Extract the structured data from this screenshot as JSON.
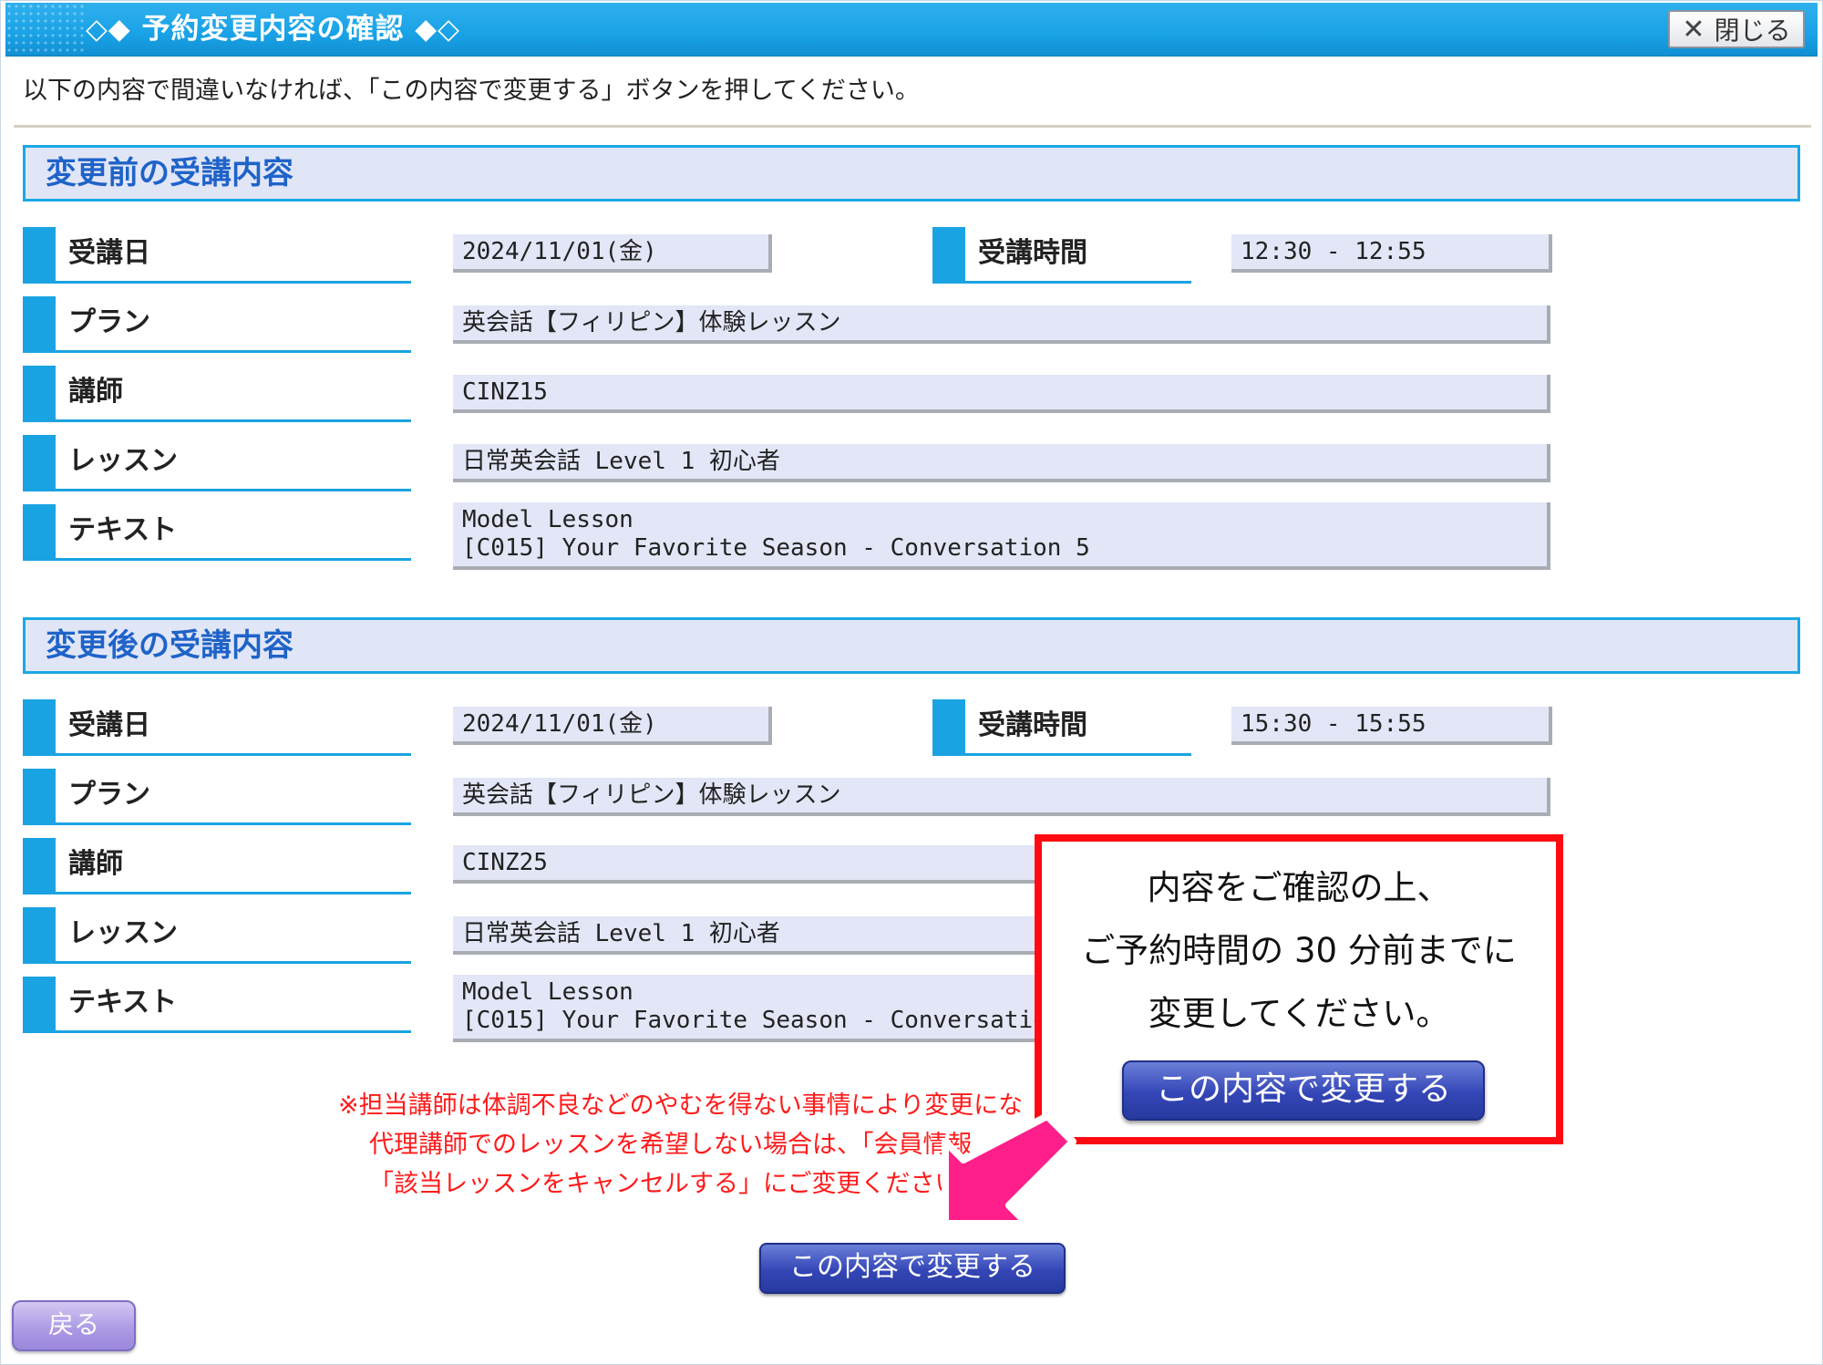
{
  "window": {
    "title": "◇◆ 予約変更内容の確認 ◆◇",
    "close_label": "閉じる"
  },
  "instruction": "以下の内容で間違いなければ、「この内容で変更する」ボタンを押してください。",
  "before": {
    "heading": "変更前の受講内容",
    "date_label": "受講日",
    "date": "2024/11/01(金)",
    "time_label": "受講時間",
    "time": "12:30 - 12:55",
    "plan_label": "プラン",
    "plan": "英会話【フィリピン】体験レッスン",
    "teacher_label": "講師",
    "teacher": "CINZ15",
    "lesson_label": "レッスン",
    "lesson": "日常英会話 Level 1 初心者",
    "text_label": "テキスト",
    "text_line1": "Model Lesson",
    "text_line2": "[C015] Your Favorite Season - Conversation 5"
  },
  "after": {
    "heading": "変更後の受講内容",
    "date_label": "受講日",
    "date": "2024/11/01(金)",
    "time_label": "受講時間",
    "time": "15:30 - 15:55",
    "plan_label": "プラン",
    "plan": "英会話【フィリピン】体験レッスン",
    "teacher_label": "講師",
    "teacher": "CINZ25",
    "lesson_label": "レッスン",
    "lesson": "日常英会話 Level 1 初心者",
    "text_label": "テキスト",
    "text_line1": "Model Lesson",
    "text_line2": "[C015] Your Favorite Season - Conversation 5"
  },
  "notice": {
    "line1": "※担当講師は体調不良などのやむを得ない事情により変更にな",
    "line2": "代理講師でのレッスンを希望しない場合は、「会員情報",
    "line3": "「該当レッスンをキャンセルする」にご変更ください。"
  },
  "buttons": {
    "confirm_label": "この内容で変更する",
    "back_label": "戻る"
  },
  "callout": {
    "line1": "内容をご確認の上、",
    "line2": "ご予約時間の 30 分前までに",
    "line3": "変更してください。",
    "button_label": "この内容で変更する"
  },
  "colors": {
    "titlebar": "#19a2e6",
    "accent_blue": "#1aa3e2",
    "heading_text": "#1f63c9",
    "value_bg": "#e2e6f6",
    "notice_red": "#ff1a1a",
    "callout_border": "#ff0a12",
    "arrow_pink": "#ff1f8a"
  },
  "icons": {
    "close": "close-icon",
    "arrow": "arrow-pointer-icon"
  }
}
